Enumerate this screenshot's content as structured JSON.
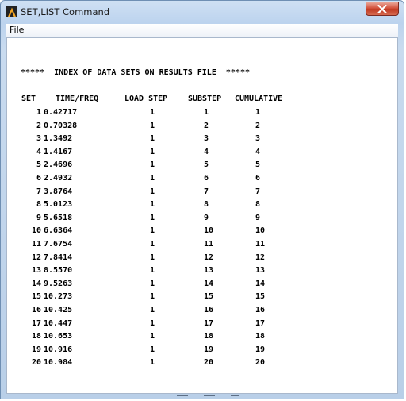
{
  "window": {
    "title": "SET,LIST Command",
    "close_symbol": "✕",
    "colors": {
      "close": "#c03a22",
      "frame": "#bcd3ee",
      "icon": "#f5a623"
    }
  },
  "menu": {
    "file_label": "File"
  },
  "icons": {
    "app": "ansys-logo-icon",
    "close": "close-icon"
  },
  "content": {
    "index_line": "*****  INDEX OF DATA SETS ON RESULTS FILE  *****",
    "headers": {
      "set": "SET",
      "time_freq": "TIME/FREQ",
      "load_step": "LOAD STEP",
      "substep": "SUBSTEP",
      "cumulative": "CUMULATIVE"
    },
    "rows": [
      {
        "set": "1",
        "time": "0.42717",
        "load": "1",
        "sub": "1",
        "cum": "1"
      },
      {
        "set": "2",
        "time": "0.70328",
        "load": "1",
        "sub": "2",
        "cum": "2"
      },
      {
        "set": "3",
        "time": "1.3492",
        "load": "1",
        "sub": "3",
        "cum": "3"
      },
      {
        "set": "4",
        "time": "1.4167",
        "load": "1",
        "sub": "4",
        "cum": "4"
      },
      {
        "set": "5",
        "time": "2.4696",
        "load": "1",
        "sub": "5",
        "cum": "5"
      },
      {
        "set": "6",
        "time": "2.4932",
        "load": "1",
        "sub": "6",
        "cum": "6"
      },
      {
        "set": "7",
        "time": "3.8764",
        "load": "1",
        "sub": "7",
        "cum": "7"
      },
      {
        "set": "8",
        "time": "5.0123",
        "load": "1",
        "sub": "8",
        "cum": "8"
      },
      {
        "set": "9",
        "time": "5.6518",
        "load": "1",
        "sub": "9",
        "cum": "9"
      },
      {
        "set": "10",
        "time": "6.6364",
        "load": "1",
        "sub": "10",
        "cum": "10"
      },
      {
        "set": "11",
        "time": "7.6754",
        "load": "1",
        "sub": "11",
        "cum": "11"
      },
      {
        "set": "12",
        "time": "7.8414",
        "load": "1",
        "sub": "12",
        "cum": "12"
      },
      {
        "set": "13",
        "time": "8.5570",
        "load": "1",
        "sub": "13",
        "cum": "13"
      },
      {
        "set": "14",
        "time": "9.5263",
        "load": "1",
        "sub": "14",
        "cum": "14"
      },
      {
        "set": "15",
        "time": "10.273",
        "load": "1",
        "sub": "15",
        "cum": "15"
      },
      {
        "set": "16",
        "time": "10.425",
        "load": "1",
        "sub": "16",
        "cum": "16"
      },
      {
        "set": "17",
        "time": "10.447",
        "load": "1",
        "sub": "17",
        "cum": "17"
      },
      {
        "set": "18",
        "time": "10.653",
        "load": "1",
        "sub": "18",
        "cum": "18"
      },
      {
        "set": "19",
        "time": "10.916",
        "load": "1",
        "sub": "19",
        "cum": "19"
      },
      {
        "set": "20",
        "time": "10.984",
        "load": "1",
        "sub": "20",
        "cum": "20"
      }
    ]
  }
}
